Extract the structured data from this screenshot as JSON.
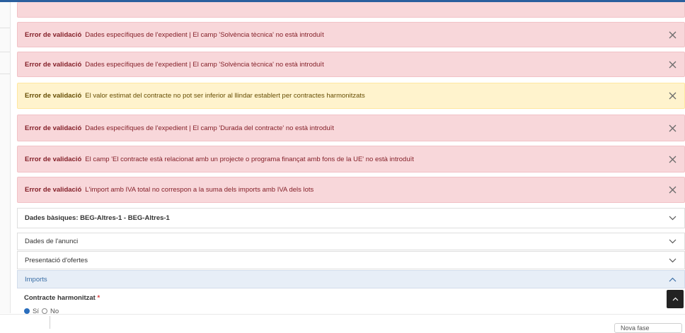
{
  "alerts": [
    {
      "type": "danger",
      "title": "Error de validació",
      "message": "Dades específiques de l'expedient | El camp 'Solvència tècnica' no està introduït"
    },
    {
      "type": "danger",
      "title": "Error de validació",
      "message": "Dades específiques de l'expedient | El camp 'Solvència tècnica' no està introduït"
    },
    {
      "type": "warning",
      "title": "Error de validació",
      "message": "El valor estimat del contracte no pot ser inferior al llindar establert per contractes harmonitzats"
    },
    {
      "type": "danger",
      "title": "Error de validació",
      "message": "Dades específiques de l'expedient | El camp 'Durada del contracte' no està introduït"
    },
    {
      "type": "danger",
      "title": "Error de validació",
      "message": "El camp 'El contracte està relacionat amb un projecte o programa finançat amb fons de la UE' no està introduït"
    },
    {
      "type": "danger",
      "title": "Error de validació",
      "message": "L'import amb IVA total no correspon a la suma dels imports amb IVA dels lots"
    }
  ],
  "accordion": [
    {
      "label": "Dades bàsiques:  BEG-Altres-1 - BEG-Altres-1",
      "expanded": false
    },
    {
      "label": "Dades de l'anunci",
      "expanded": false
    },
    {
      "label": "Presentació d'ofertes",
      "expanded": false
    },
    {
      "label": "Imports",
      "expanded": true
    }
  ],
  "imports_section": {
    "field_label": "Contracte harmonitzat",
    "required_mark": "*",
    "options": [
      {
        "label": "Sí",
        "selected": true
      },
      {
        "label": "No",
        "selected": false
      }
    ]
  },
  "footer": {
    "button_label": "Nova fase"
  },
  "colors": {
    "accent": "#2a5f9e",
    "danger_bg": "#f8d7da",
    "warning_bg": "#fff3cd",
    "active_bg": "#e7eef7"
  }
}
